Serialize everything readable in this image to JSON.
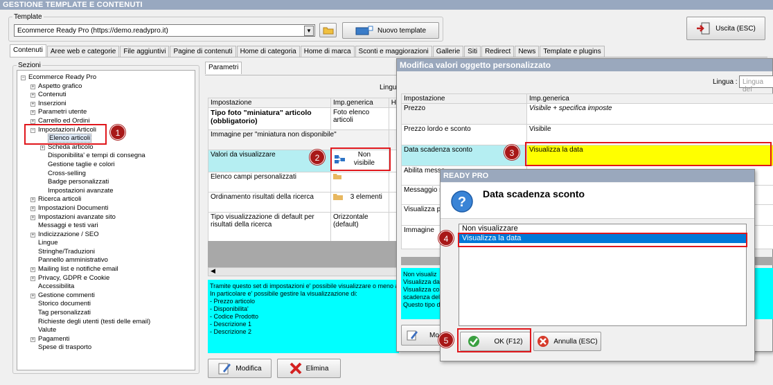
{
  "window": {
    "title": "GESTIONE TEMPLATE E CONTENUTI"
  },
  "template": {
    "legend": "Template",
    "selected": "Ecommerce Ready Pro (https://demo.readypro.it)",
    "new_button": "Nuovo template",
    "exit_button": "Uscita (ESC)"
  },
  "tabs": [
    "Contenuti",
    "Aree web e categorie",
    "File aggiuntivi",
    "Pagine di contenuti",
    "Home di categoria",
    "Home di marca",
    "Sconti e maggiorazioni",
    "Gallerie",
    "Siti",
    "Redirect",
    "News",
    "Template e plugins"
  ],
  "sections": {
    "legend": "Sezioni",
    "root": "Ecommerce Ready Pro",
    "items": [
      {
        "label": "Aspetto grafico",
        "level": 1,
        "expand": true
      },
      {
        "label": "Contenuti",
        "level": 1,
        "expand": true
      },
      {
        "label": "Inserzioni",
        "level": 1,
        "expand": true
      },
      {
        "label": "Parametri utente",
        "level": 1,
        "expand": true
      },
      {
        "label": "Carrello ed Ordini",
        "level": 1,
        "expand": true
      },
      {
        "label": "Impostazioni Articoli",
        "level": 1,
        "expand": "open"
      },
      {
        "label": "Elenco articoli",
        "level": 2,
        "expand": false,
        "selected": true
      },
      {
        "label": "Scheda articolo",
        "level": 2,
        "expand": true
      },
      {
        "label": "Disponibilita' e tempi di consegna",
        "level": 2,
        "expand": false
      },
      {
        "label": "Gestione taglie e colori",
        "level": 2,
        "expand": false
      },
      {
        "label": "Cross-selling",
        "level": 2,
        "expand": false
      },
      {
        "label": "Badge personalizzati",
        "level": 2,
        "expand": false
      },
      {
        "label": "Impostazioni avanzate",
        "level": 2,
        "expand": false
      },
      {
        "label": "Ricerca articoli",
        "level": 1,
        "expand": true
      },
      {
        "label": "Impostazioni Documenti",
        "level": 1,
        "expand": true
      },
      {
        "label": "Impostazioni avanzate sito",
        "level": 1,
        "expand": true
      },
      {
        "label": "Messaggi e testi vari",
        "level": 1,
        "expand": false
      },
      {
        "label": "Indicizzazione / SEO",
        "level": 1,
        "expand": true
      },
      {
        "label": "Lingue",
        "level": 1,
        "expand": false
      },
      {
        "label": "Stringhe/Traduzioni",
        "level": 1,
        "expand": false
      },
      {
        "label": "Pannello amministrativo",
        "level": 1,
        "expand": false
      },
      {
        "label": "Mailing list e notifiche email",
        "level": 1,
        "expand": true
      },
      {
        "label": "Privacy, GDPR e Cookie",
        "level": 1,
        "expand": true
      },
      {
        "label": "Accessibilita",
        "level": 1,
        "expand": false
      },
      {
        "label": "Gestione commenti",
        "level": 1,
        "expand": true
      },
      {
        "label": "Storico documenti",
        "level": 1,
        "expand": false
      },
      {
        "label": "Tag personalizzati",
        "level": 1,
        "expand": false
      },
      {
        "label": "Richieste degli utenti (testi delle email)",
        "level": 1,
        "expand": false
      },
      {
        "label": "Valute",
        "level": 1,
        "expand": false
      },
      {
        "label": "Pagamenti",
        "level": 1,
        "expand": true
      },
      {
        "label": "Spese di trasporto",
        "level": 1,
        "expand": false
      }
    ]
  },
  "params": {
    "tab": "Parametri",
    "lingua_partial": "Lingu",
    "col_setting": "Impostazione",
    "col_generic": "Imp.generica",
    "col_h": "H",
    "rows": [
      {
        "setting": "Tipo foto \"miniatura\" articolo (obbligatorio)",
        "value": "Foto elenco articoli"
      },
      {
        "setting": "Immagine per \"miniatura non disponibile\"",
        "value": ""
      },
      {
        "setting": "Valori da visualizzare",
        "value": "Non visibile"
      },
      {
        "setting": "Elenco campi personalizzati",
        "value": ""
      },
      {
        "setting": "Ordinamento risultati della ricerca",
        "value": "3 elementi"
      },
      {
        "setting": "Tipo visualizzazione di default per risultati della ricerca",
        "value": "Orizzontale (default)"
      }
    ],
    "description": [
      "Tramite questo set di impostazioni e' possibile visualizzare o meno al",
      "In particolare e' possibile gestire la visualizzazione di:",
      "- Prezzo articolo",
      "- Disponibilita'",
      "- Codice Prodotto",
      "- Descrizione 1",
      "- Descrizione 2"
    ],
    "edit_button": "Modifica",
    "delete_button": "Elimina"
  },
  "custom_dialog": {
    "title": "Modifica valori oggetto personalizzato",
    "lingua_label": "Lingua :",
    "lingua_placeholder": "Lingua def",
    "col_setting": "Impostazione",
    "col_generic": "Imp.generica",
    "rows": [
      {
        "setting": "Prezzo",
        "value": "Visibile + specifica imposte"
      },
      {
        "setting": "Prezzo lordo e sconto",
        "value": "Visibile"
      },
      {
        "setting": "Data scadenza sconto",
        "value": "Visualizza la data"
      },
      {
        "setting": "Abilita messa",
        "value": ""
      },
      {
        "setting": "Messaggio sco",
        "value": ""
      },
      {
        "setting": "Visualizza pu",
        "value": ""
      },
      {
        "setting": "Immagine",
        "value": ""
      }
    ],
    "description": [
      "Non visualiz",
      "Visualizza dat",
      "Visualizza con",
      "scadenza del",
      "Questo tipo d"
    ],
    "modify_button_partial": "Mo"
  },
  "choice_dialog": {
    "title": "READY PRO",
    "question": "Data scadenza sconto",
    "options": [
      "Non visualizzare",
      "Visualizza la data"
    ],
    "selected_index": 1,
    "ok_button": "OK (F12)",
    "cancel_button": "Annulla (ESC)"
  },
  "badges": [
    "1",
    "2",
    "3",
    "4",
    "5"
  ],
  "colors": {
    "highlight_red": "#e0161b",
    "selection_blue": "#0078d7",
    "cyan": "#00ffff",
    "yellow": "#ffff00",
    "badge": "#a81818"
  }
}
